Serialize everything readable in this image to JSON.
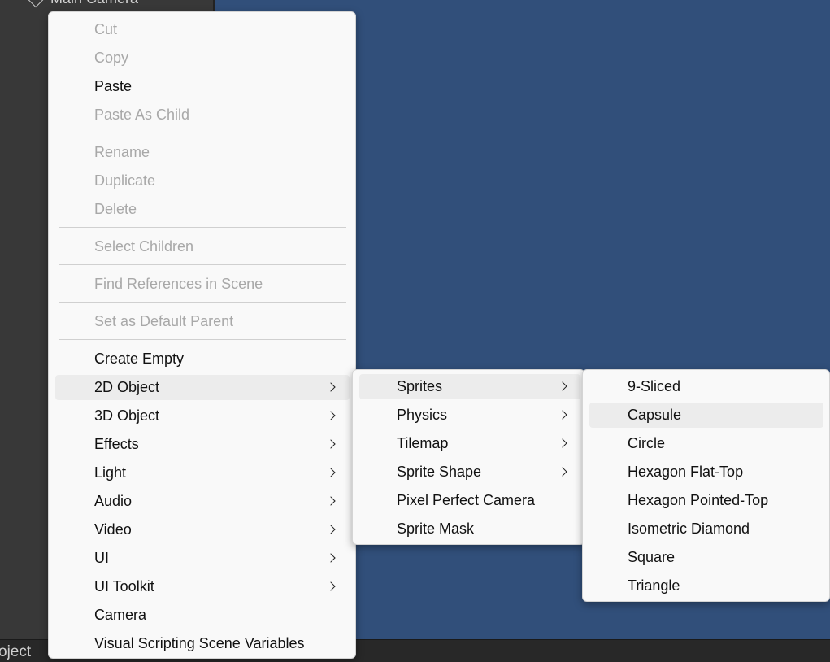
{
  "hierarchy": {
    "row_label": "Main Camera"
  },
  "status_bar": {
    "text": "oject"
  },
  "context_menu": {
    "items": [
      {
        "label": "Cut"
      },
      {
        "label": "Copy"
      },
      {
        "label": "Paste"
      },
      {
        "label": "Paste As Child"
      },
      {
        "label": "Rename"
      },
      {
        "label": "Duplicate"
      },
      {
        "label": "Delete"
      },
      {
        "label": "Select Children"
      },
      {
        "label": "Find References in Scene"
      },
      {
        "label": "Set as Default Parent"
      },
      {
        "label": "Create Empty"
      },
      {
        "label": "2D Object"
      },
      {
        "label": "3D Object"
      },
      {
        "label": "Effects"
      },
      {
        "label": "Light"
      },
      {
        "label": "Audio"
      },
      {
        "label": "Video"
      },
      {
        "label": "UI"
      },
      {
        "label": "UI Toolkit"
      },
      {
        "label": "Camera"
      },
      {
        "label": "Visual Scripting Scene Variables"
      }
    ]
  },
  "submenu_2d": {
    "items": [
      {
        "label": "Sprites"
      },
      {
        "label": "Physics"
      },
      {
        "label": "Tilemap"
      },
      {
        "label": "Sprite Shape"
      },
      {
        "label": "Pixel Perfect Camera"
      },
      {
        "label": "Sprite Mask"
      }
    ]
  },
  "submenu_sprites": {
    "items": [
      {
        "label": "9-Sliced"
      },
      {
        "label": "Capsule"
      },
      {
        "label": "Circle"
      },
      {
        "label": "Hexagon Flat-Top"
      },
      {
        "label": "Hexagon Pointed-Top"
      },
      {
        "label": "Isometric Diamond"
      },
      {
        "label": "Square"
      },
      {
        "label": "Triangle"
      }
    ]
  },
  "colors": {
    "scene_background": "#314f7a",
    "panel_background": "#383838",
    "menu_background": "#f9f9f9",
    "highlight": "#ececec",
    "disabled_text": "#a8a8a8"
  }
}
